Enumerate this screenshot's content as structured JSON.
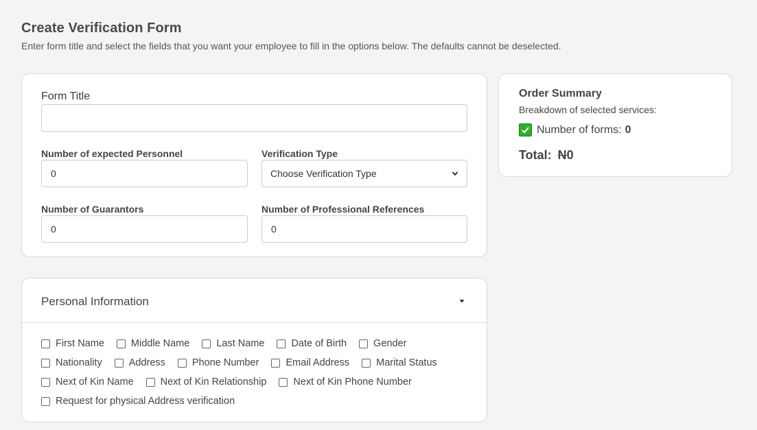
{
  "header": {
    "title": "Create Verification Form",
    "subtitle": "Enter form title and select the fields that you want your employee to fill in the options below. The defaults cannot be deselected."
  },
  "form": {
    "form_title_label": "Form Title",
    "form_title_value": "",
    "personnel_label": "Number of expected Personnel",
    "personnel_value": "0",
    "verification_type_label": "Verification Type",
    "verification_type_value": "Choose Verification Type",
    "guarantors_label": "Number of Guarantors",
    "guarantors_value": "0",
    "references_label": "Number of Professional References",
    "references_value": "0"
  },
  "summary": {
    "title": "Order Summary",
    "subtitle": "Breakdown of selected services:",
    "forms_label": "Number of forms:",
    "forms_value": "0",
    "total_label": "Total:",
    "currency": "N",
    "total_value": "0"
  },
  "personal": {
    "title": "Personal Information",
    "rows": [
      [
        "First Name",
        "Middle Name",
        "Last Name",
        "Date of Birth",
        "Gender"
      ],
      [
        "Nationality",
        "Address",
        "Phone Number",
        "Email Address",
        "Marital Status"
      ],
      [
        "Next of Kin Name",
        "Next of Kin Relationship",
        "Next of Kin Phone Number"
      ],
      [
        "Request for physical Address verification"
      ]
    ]
  },
  "icons": {
    "select_chevron": "chevron-down-icon",
    "summary_check": "check-icon",
    "collapse_caret": "caret-down-icon"
  },
  "colors": {
    "check_green": "#2fae2f"
  }
}
